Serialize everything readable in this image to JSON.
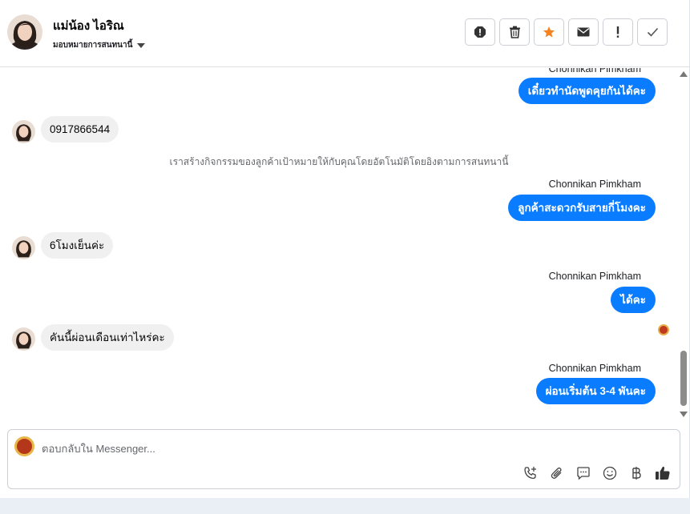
{
  "header": {
    "contact_name": "แม่น้อง ไอริณ",
    "assign_label": "มอบหมายการสนทนานี้",
    "actions": [
      "spam-icon",
      "trash-icon",
      "star-icon",
      "mail-icon",
      "exclamation-icon",
      "check-icon"
    ],
    "star_color": "#f5821f"
  },
  "messages": {
    "m1_sender": "Chonnikan Pimkham",
    "m1_text": "เดี๋ยวทำนัดพูดคุยกันได้คะ",
    "m2_text": "0917866544",
    "system_note": "เราสร้างกิจกรรมของลูกค้าเป้าหมายให้กับคุณโดยอัตโนมัติโดยอิงตามการสนทนานี้",
    "m3_sender": "Chonnikan Pimkham",
    "m3_text": "ลูกค้าสะดวกรับสายกี่โมงคะ",
    "m4_text": "6โมงเย็นค่ะ",
    "m5_sender": "Chonnikan Pimkham",
    "m5_text": "ได้คะ",
    "m6_text": "คันนี้ผ่อนเดือนเท่าไหร่คะ",
    "m7_sender": "Chonnikan Pimkham",
    "m7_text": "ผ่อนเริ่มต้น 3-4 พันคะ"
  },
  "composer": {
    "placeholder": "ตอบกลับใน Messenger...",
    "tools": [
      "add-call-icon",
      "attachment-icon",
      "saved-reply-icon",
      "emoji-icon",
      "baht-icon",
      "like-icon"
    ]
  },
  "colors": {
    "accent": "#0a7cff",
    "incoming_bubble": "#f0f0f0"
  }
}
